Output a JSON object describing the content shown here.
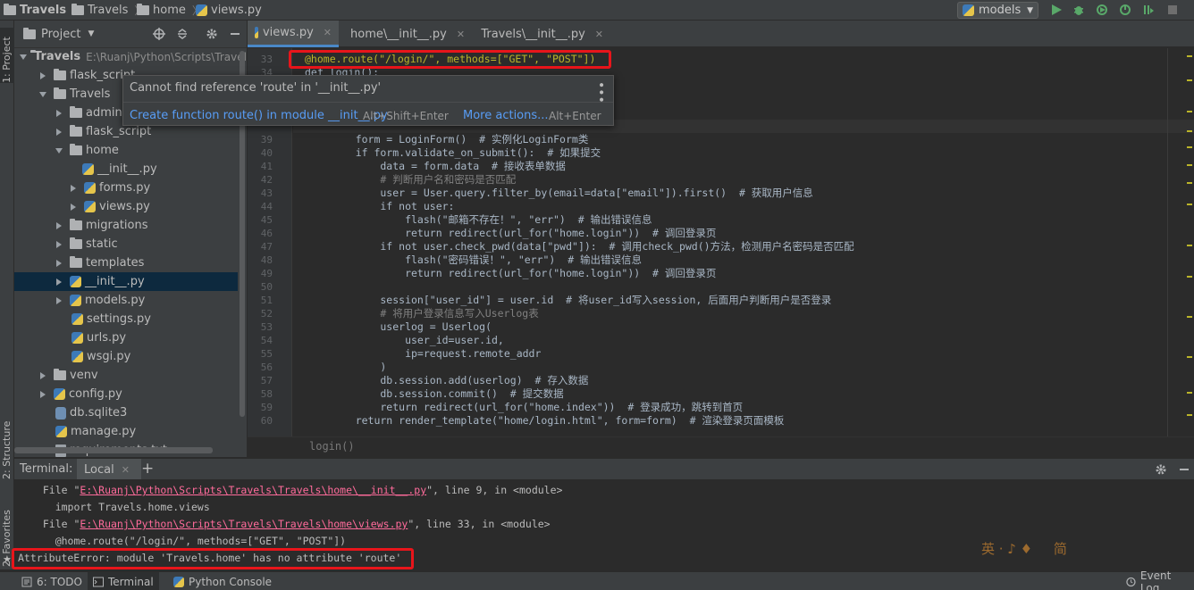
{
  "navbar": {
    "crumbs": [
      "Travels",
      "Travels",
      "home",
      "views.py"
    ],
    "run_config": "models"
  },
  "left_strip": {
    "project": "1: Project",
    "structure": "2: Structure",
    "favorites": "2: Favorites"
  },
  "project_panel": {
    "title": "Project",
    "tree": [
      {
        "label": "Travels",
        "path": "E:\\Ruanj\\Python\\Scripts\\Travels"
      },
      {
        "label": "flask_script"
      },
      {
        "label": "Travels"
      },
      {
        "label": "admin"
      },
      {
        "label": "flask_script"
      },
      {
        "label": "home"
      },
      {
        "label": "__init__.py"
      },
      {
        "label": "forms.py"
      },
      {
        "label": "views.py"
      },
      {
        "label": "migrations"
      },
      {
        "label": "static"
      },
      {
        "label": "templates"
      },
      {
        "label": "__init__.py"
      },
      {
        "label": "models.py"
      },
      {
        "label": "settings.py"
      },
      {
        "label": "urls.py"
      },
      {
        "label": "wsgi.py"
      },
      {
        "label": "venv"
      },
      {
        "label": "config.py"
      },
      {
        "label": "db.sqlite3"
      },
      {
        "label": "manage.py"
      },
      {
        "label": "requirements.txt"
      }
    ]
  },
  "editor": {
    "tabs": [
      "views.py",
      "home\\__init__.py",
      "Travels\\__init__.py"
    ],
    "lines": [
      {
        "n": "33",
        "text": "@home.route(\"/login/\", methods=[\"GET\", \"POST\"])"
      },
      {
        "n": "34",
        "text": "def login():"
      },
      {
        "n": "39",
        "text": "    form = LoginForm()  # 实例化LoginForm类"
      },
      {
        "n": "40",
        "text": "    if form.validate_on_submit():  # 如果提交"
      },
      {
        "n": "41",
        "text": "        data = form.data  # 接收表单数据"
      },
      {
        "n": "42",
        "text": "        # 判断用户名和密码是否匹配"
      },
      {
        "n": "43",
        "text": "        user = User.query.filter_by(email=data[\"email\"]).first()  # 获取用户信息"
      },
      {
        "n": "44",
        "text": "        if not user:"
      },
      {
        "n": "45",
        "text": "            flash(\"邮箱不存在！\", \"err\")  # 输出错误信息"
      },
      {
        "n": "46",
        "text": "            return redirect(url_for(\"home.login\"))  # 调回登录页"
      },
      {
        "n": "47",
        "text": "        if not user.check_pwd(data[\"pwd\"]):  # 调用check_pwd()方法，检测用户名密码是否匹配"
      },
      {
        "n": "48",
        "text": "            flash(\"密码错误！\", \"err\")  # 输出错误信息"
      },
      {
        "n": "49",
        "text": "            return redirect(url_for(\"home.login\"))  # 调回登录页"
      },
      {
        "n": "50",
        "text": ""
      },
      {
        "n": "51",
        "text": "        session[\"user_id\"] = user.id  # 将user_id写入session, 后面用户判断用户是否登录"
      },
      {
        "n": "52",
        "text": "        # 将用户登录信息写入Userlog表"
      },
      {
        "n": "53",
        "text": "        userlog = Userlog("
      },
      {
        "n": "54",
        "text": "            user_id=user.id,"
      },
      {
        "n": "55",
        "text": "            ip=request.remote_addr"
      },
      {
        "n": "56",
        "text": "        )"
      },
      {
        "n": "57",
        "text": "        db.session.add(userlog)  # 存入数据"
      },
      {
        "n": "58",
        "text": "        db.session.commit()  # 提交数据"
      },
      {
        "n": "59",
        "text": "        return redirect(url_for(\"home.index\"))  # 登录成功，跳转到首页"
      },
      {
        "n": "60",
        "text": "    return render_template(\"home/login.html\", form=form)  # 渲染登录页面模板"
      }
    ],
    "breadcrumb": "login()"
  },
  "popup": {
    "message": "Cannot find reference 'route' in '__init__.py'",
    "action": "Create function route() in module __init__.py",
    "action_shortcut": "Alt+Shift+Enter",
    "more": "More actions...",
    "more_shortcut": "Alt+Enter"
  },
  "terminal": {
    "label": "Terminal:",
    "tab": "Local",
    "lines": [
      {
        "prefix": "  File \"",
        "link": "E:\\Ruanj\\Python\\Scripts\\Travels\\Travels\\home\\__init__.py",
        "suffix": "\", line 9, in <module>"
      },
      {
        "prefix": "    import Travels.home.views",
        "link": "",
        "suffix": ""
      },
      {
        "prefix": "  File \"",
        "link": "E:\\Ruanj\\Python\\Scripts\\Travels\\Travels\\home\\views.py",
        "suffix": "\", line 33, in <module>"
      },
      {
        "prefix": "    @home.route(\"/login/\", methods=[\"GET\", \"POST\"])",
        "link": "",
        "suffix": ""
      },
      {
        "prefix": "AttributeError: module 'Travels.home' has no attribute 'route'",
        "link": "",
        "suffix": ""
      }
    ],
    "watermark": "英 · ♪ ♦     简"
  },
  "bottom_bar": {
    "todo": "6: TODO",
    "terminal": "Terminal",
    "python_console": "Python Console",
    "event_log": "Event Log"
  },
  "colors": {
    "accent": "#4a88c7",
    "annotation": "#e8151b",
    "link": "#589df6"
  }
}
